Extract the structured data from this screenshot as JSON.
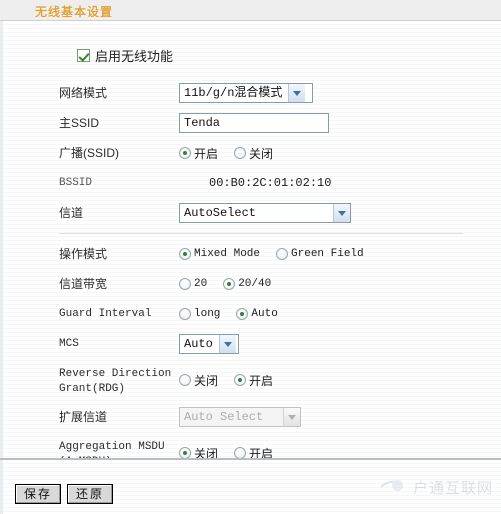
{
  "header": {
    "title": "无线基本设置"
  },
  "enable": {
    "label": "启用无线功能",
    "checked": true
  },
  "fields": {
    "network_mode": {
      "label": "网络模式",
      "value": "11b/g/n混合模式"
    },
    "main_ssid": {
      "label": "主SSID",
      "value": "Tenda",
      "placeholder": ""
    },
    "broadcast_ssid": {
      "label": "广播(SSID)",
      "options": [
        "开启",
        "关闭"
      ],
      "selected": "开启"
    },
    "bssid": {
      "label": "BSSID",
      "value": "00:B0:2C:01:02:10"
    },
    "channel": {
      "label": "信道",
      "value": "AutoSelect"
    },
    "operating_mode": {
      "label": "操作模式",
      "options": [
        "Mixed Mode",
        "Green Field"
      ],
      "selected": "Mixed Mode"
    },
    "channel_bandwidth": {
      "label": "信道带宽",
      "options": [
        "20",
        "20/40"
      ],
      "selected": "20/40"
    },
    "guard_interval": {
      "label": "Guard Interval",
      "options": [
        "long",
        "Auto"
      ],
      "selected": "Auto"
    },
    "mcs": {
      "label": "MCS",
      "value": "Auto"
    },
    "rdg": {
      "label": "Reverse Direction\nGrant(RDG)",
      "options": [
        "关闭",
        "开启"
      ],
      "selected": "开启"
    },
    "extension_channel": {
      "label": "扩展信道",
      "value": "Auto Select",
      "disabled": true
    },
    "amsdu": {
      "label": "Aggregation MSDU\n(A-MSDU)",
      "options": [
        "关闭",
        "开启"
      ],
      "selected": "关闭"
    }
  },
  "footer": {
    "save_label": "保存",
    "restore_label": "还原"
  },
  "watermark": {
    "text": "户通互联网"
  },
  "colors": {
    "header_title": "#e0a33c",
    "radio_dot": "#3a7d3a",
    "checkbox_check": "#2e8b2e"
  }
}
